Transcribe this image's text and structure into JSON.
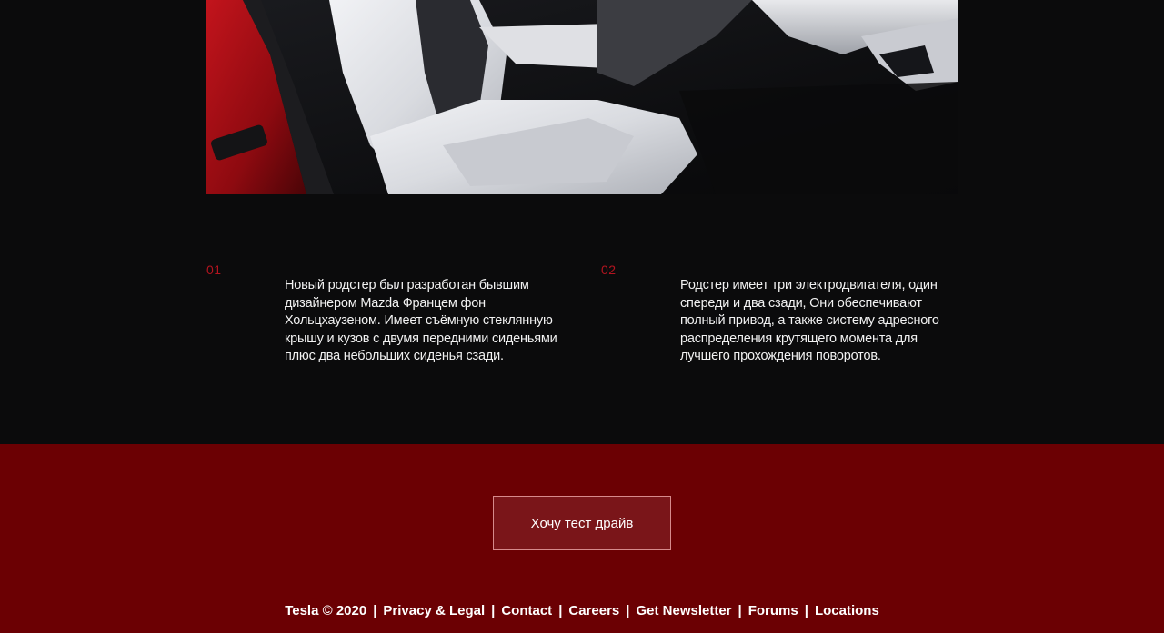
{
  "features": [
    {
      "number": "01",
      "text": "Новый родстер был разработан бывшим дизайнером Mazda Францем фон Хольцхаузеном. Имеет съёмную стеклянную крышу и кузов с двумя передними сиденьями плюс два небольших сиденья сзади."
    },
    {
      "number": "02",
      "text": "Родстер имеет три электродвигателя, один спереди и два сзади, Они обеспечивают полный привод, а также систему адресного распределения крутящего момента для лучшего прохождения поворотов."
    }
  ],
  "cta": {
    "label": "Хочу тест драйв"
  },
  "footer": {
    "copyright": "Tesla © 2020",
    "separator": "|",
    "links": [
      "Privacy & Legal",
      "Contact",
      "Careers",
      "Get Newsletter",
      "Forums",
      "Locations"
    ]
  },
  "colors": {
    "background": "#0b0b0c",
    "accent_number": "#b3141f",
    "red_band": "#6b0003",
    "button_fill": "#7a1519",
    "button_border": "#d68a8c"
  }
}
